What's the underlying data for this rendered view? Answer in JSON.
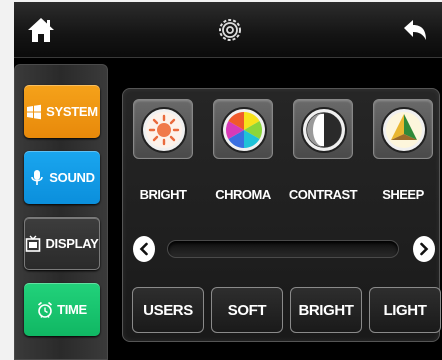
{
  "topbar": {
    "home_icon": "home-icon",
    "settings_icon": "gear-icon",
    "back_icon": "back-arrow-icon"
  },
  "sidebar": {
    "items": [
      {
        "label": "SYSTEM",
        "icon": "windows-icon",
        "color": "#f29a14"
      },
      {
        "label": "SOUND",
        "icon": "microphone-icon",
        "color": "#1599e6"
      },
      {
        "label": "DISPLAY",
        "icon": "display-icon",
        "color": "#333333"
      },
      {
        "label": "TIME",
        "icon": "alarm-clock-icon",
        "color": "#18c56f"
      }
    ]
  },
  "picture": {
    "modes": [
      {
        "label": "BRIGHT",
        "icon": "brightness-sun-icon"
      },
      {
        "label": "CHROMA",
        "icon": "color-wheel-icon"
      },
      {
        "label": "CONTRAST",
        "icon": "contrast-icon"
      },
      {
        "label": "SHEEP",
        "icon": "sharpness-icon"
      }
    ],
    "presets": [
      "USERS",
      "SOFT",
      "BRIGHT",
      "LIGHT"
    ]
  }
}
